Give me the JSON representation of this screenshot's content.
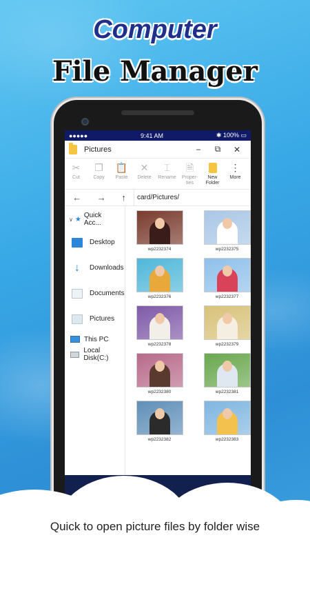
{
  "promo": {
    "headline_line1": "Computer",
    "headline_line2": "File Manager",
    "caption": "Quick to open picture files by folder wise"
  },
  "statusbar": {
    "signal": "●●●●●",
    "time": "9:41 AM",
    "battery": "100%"
  },
  "window": {
    "title": "Pictures",
    "minimize": "−",
    "maximize": "⧉",
    "close": "✕"
  },
  "ribbon": [
    {
      "label": "Cut",
      "icon": "scissors-icon",
      "glyph": "✂",
      "enabled": false
    },
    {
      "label": "Copy",
      "icon": "copy-icon",
      "glyph": "❐",
      "enabled": false
    },
    {
      "label": "Paste",
      "icon": "paste-icon",
      "glyph": "📋",
      "enabled": false
    },
    {
      "label": "Delete",
      "icon": "delete-icon",
      "glyph": "✕",
      "enabled": false
    },
    {
      "label": "Rename",
      "icon": "rename-icon",
      "glyph": "⌶",
      "enabled": false
    },
    {
      "label": "Proper-\nties",
      "icon": "properties-icon",
      "glyph": "🗎",
      "enabled": false
    },
    {
      "label": "New\nFolder",
      "icon": "new-folder-icon",
      "glyph": "",
      "enabled": true
    },
    {
      "label": "More",
      "icon": "more-icon",
      "glyph": "⋮",
      "enabled": true
    }
  ],
  "nav": {
    "back": "←",
    "forward": "→",
    "up": "↑",
    "path": "card/Pictures/"
  },
  "sidebar": {
    "quick_access": "Quick Acc...",
    "items": [
      {
        "label": "Desktop",
        "icon": "desktop-icon"
      },
      {
        "label": "Downloads",
        "icon": "download-icon"
      },
      {
        "label": "Documents",
        "icon": "documents-icon"
      },
      {
        "label": "Pictures",
        "icon": "pictures-icon"
      }
    ],
    "this_pc": "This PC",
    "local_disk": "Local Disk(C:)"
  },
  "files": [
    {
      "name": "wp2232374",
      "bg": "#7a3b2e",
      "coat": "#3a1d1a"
    },
    {
      "name": "wp2232375",
      "bg": "#a9c7e6",
      "coat": "#ffffff"
    },
    {
      "name": "wp2232376",
      "bg": "#4fb7d9",
      "coat": "#e8a83a"
    },
    {
      "name": "wp2232377",
      "bg": "#8fc0ea",
      "coat": "#d8435a"
    },
    {
      "name": "wp2232378",
      "bg": "#7f5aa8",
      "coat": "#f2efe9"
    },
    {
      "name": "wp2232379",
      "bg": "#d8c27a",
      "coat": "#f5efe1"
    },
    {
      "name": "wp2232380",
      "bg": "#b86a8a",
      "coat": "#5a3a2e"
    },
    {
      "name": "wp2232381",
      "bg": "#6aa84f",
      "coat": "#dfe7f0"
    },
    {
      "name": "wp2232382",
      "bg": "#5f8fb8",
      "coat": "#2b2b2b"
    },
    {
      "name": "wp2232383",
      "bg": "#7fb6e0",
      "coat": "#f2c14e"
    }
  ]
}
